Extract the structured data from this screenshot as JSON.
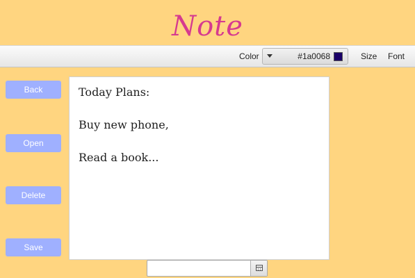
{
  "app": {
    "title": "Note"
  },
  "toolbar": {
    "color_label": "Color",
    "color_value": "#1a0068",
    "size_label": "Size",
    "font_label": "Font"
  },
  "sidebar": {
    "buttons": [
      {
        "label": "Back"
      },
      {
        "label": "Open"
      },
      {
        "label": "Delete"
      },
      {
        "label": "Save"
      }
    ]
  },
  "editor": {
    "lines": [
      "Today Plans:",
      "Buy new phone,",
      "Read a book..."
    ]
  },
  "date_picker": {
    "value": "",
    "icon": "calendar-icon"
  },
  "colors": {
    "background": "#ffd580",
    "title": "#d63a8f",
    "button": "#9fb0ff",
    "selected_color": "#1a0068"
  }
}
